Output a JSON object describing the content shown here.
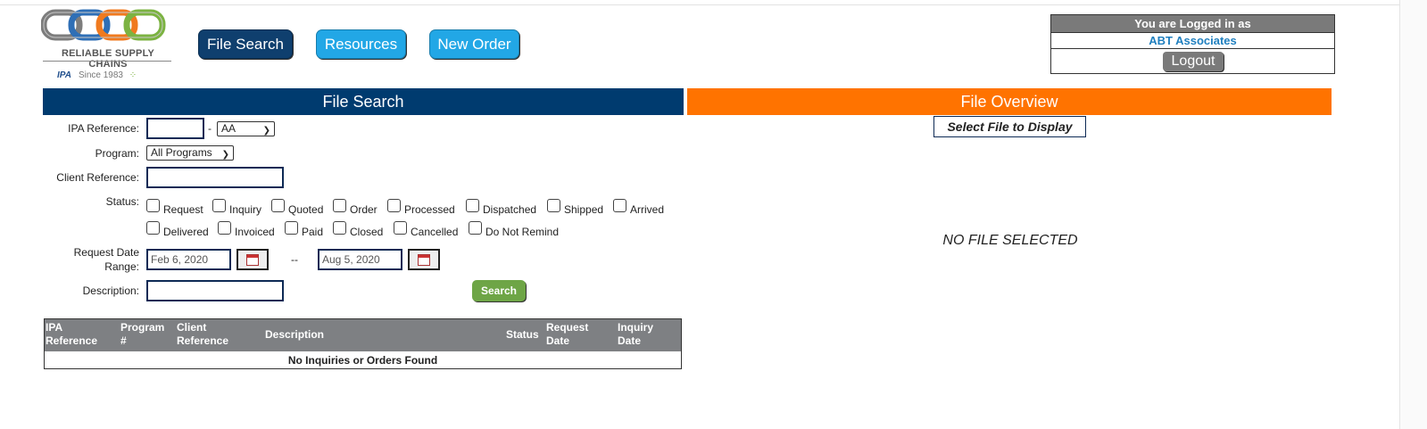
{
  "logo": {
    "wordmark": "RELIABLE SUPPLY CHAINS",
    "ipa": "IPA",
    "since": "Since 1983",
    "colors": [
      "#7d7d7d",
      "#2f6fb6",
      "#f07a1f",
      "#7cb342"
    ]
  },
  "nav": {
    "file_search": "File Search",
    "resources": "Resources",
    "new_order": "New Order"
  },
  "login": {
    "heading": "You are Logged in as",
    "user": "ABT Associates",
    "logout": "Logout"
  },
  "search_panel": {
    "title": "File Search",
    "ipa_reference_label": "IPA Reference:",
    "ipa_reference_value": "",
    "ipa_dash": "-",
    "ipa_suffix_selected": "AA",
    "program_label": "Program:",
    "program_selected": "All Programs",
    "client_reference_label": "Client Reference:",
    "client_reference_value": "",
    "status_label": "Status:",
    "statuses_row1": [
      "Request",
      "Inquiry",
      "Quoted",
      "Order",
      "Processed",
      "Dispatched",
      "Shipped",
      "Arrived"
    ],
    "statuses_row2": [
      "Delivered",
      "Invoiced",
      "Paid",
      "Closed",
      "Cancelled",
      "Do Not Remind"
    ],
    "date_range_label_1": "Request Date",
    "date_range_label_2": "Range:",
    "date_from": "Feb 6, 2020",
    "date_sep": "--",
    "date_to": "Aug 5, 2020",
    "description_label": "Description:",
    "description_value": "",
    "search_button": "Search"
  },
  "results_table": {
    "columns": [
      {
        "line1": "IPA",
        "line2": "Reference"
      },
      {
        "line1": "Program",
        "line2": "#"
      },
      {
        "line1": "Client",
        "line2": "Reference"
      },
      {
        "line1": "Description",
        "line2": ""
      },
      {
        "line1": "Status",
        "line2": ""
      },
      {
        "line1": "Request",
        "line2": "Date"
      },
      {
        "line1": "Inquiry",
        "line2": "Date"
      }
    ],
    "empty_message": "No Inquiries or Orders Found"
  },
  "overview_panel": {
    "title": "File Overview",
    "select_prompt": "Select File to Display",
    "empty_state": "NO FILE SELECTED"
  },
  "colors": {
    "navy": "#003b6f",
    "orange": "#ff7300",
    "sky": "#22a7e6",
    "green": "#6ea546",
    "gray": "#7e8083"
  }
}
